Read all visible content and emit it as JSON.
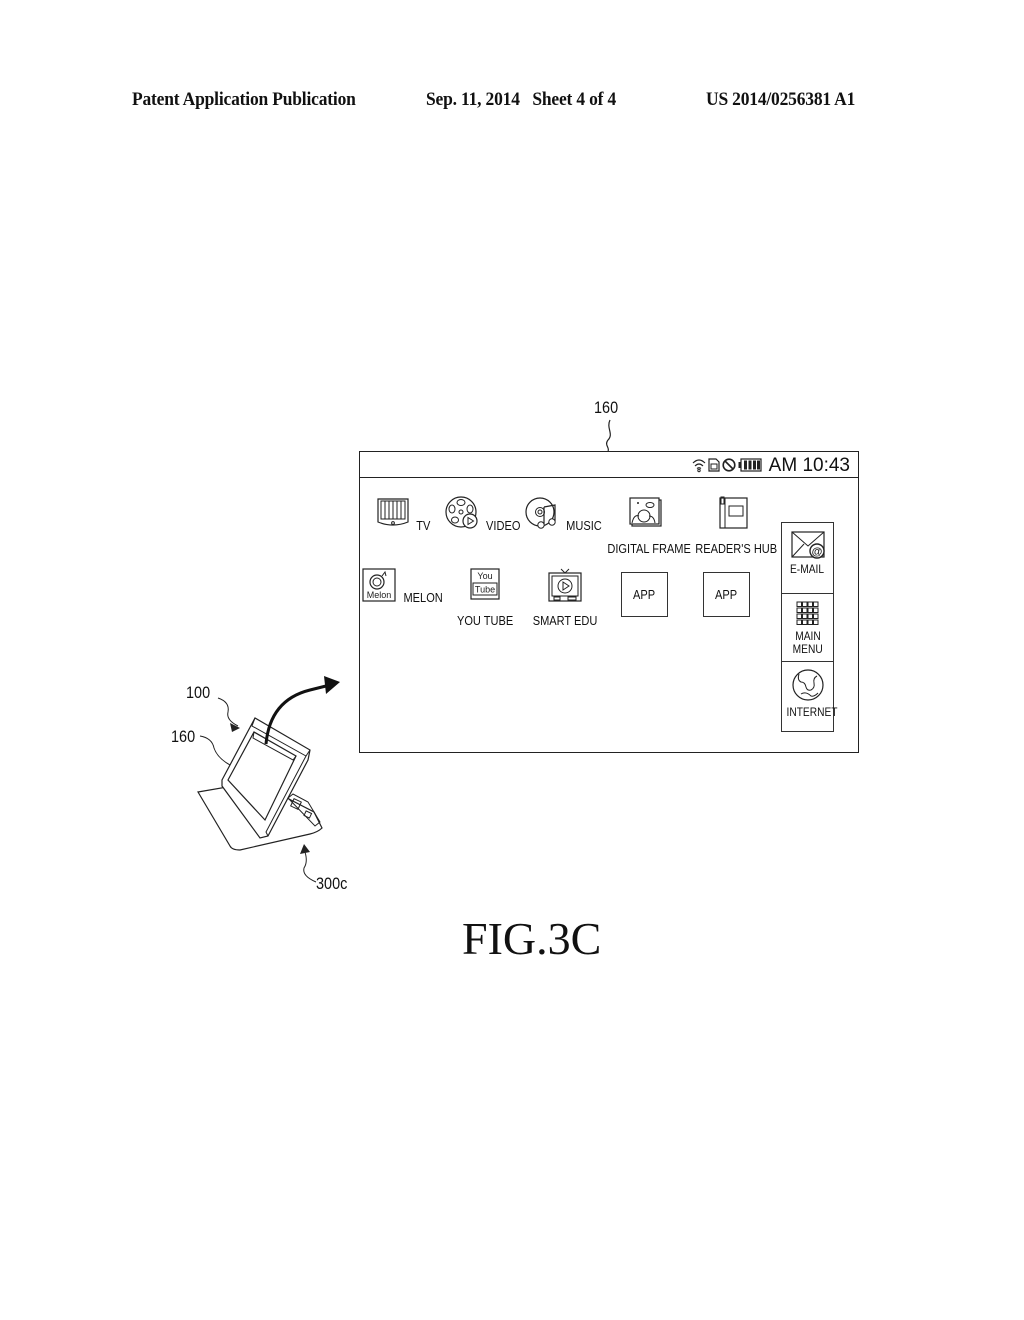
{
  "header": {
    "publication": "Patent Application Publication",
    "date_sheet": "Sep. 11, 2014   Sheet 4 of 4",
    "number": "US 2014/0256381 A1"
  },
  "figure": {
    "caption": "FIG.3C",
    "reference_labels": {
      "screen": "160",
      "device": "100",
      "device_screen": "160",
      "cover": "300c"
    }
  },
  "screen": {
    "status_bar": {
      "icons": [
        "wifi-icon",
        "sd-card-icon",
        "no-sign-icon",
        "battery-icon"
      ],
      "time": "AM 10:43"
    },
    "apps_row1": [
      {
        "label": "TV",
        "icon": "tv-icon"
      },
      {
        "label": "VIDEO",
        "icon": "film-reel-icon"
      },
      {
        "label": "MUSIC",
        "icon": "music-disc-icon"
      },
      {
        "label": "DIGITAL FRAME",
        "icon": "photo-frame-icon"
      },
      {
        "label": "READER'S HUB",
        "icon": "book-icon"
      }
    ],
    "apps_row2": [
      {
        "label": "MELON",
        "icon": "melon-icon",
        "icon_text": "Melon"
      },
      {
        "label": "YOU TUBE",
        "icon": "youtube-icon",
        "icon_text_top": "You",
        "icon_text_bottom": "Tube"
      },
      {
        "label": "SMART EDU",
        "icon": "tv-play-icon"
      }
    ],
    "placeholder_apps": [
      "APP",
      "APP"
    ],
    "dock": [
      {
        "label": "E-MAIL",
        "icon": "email-icon"
      },
      {
        "label_line1": "MAIN",
        "label_line2": "MENU",
        "icon": "grid-icon"
      },
      {
        "label": "INTERNET",
        "icon": "globe-icon"
      }
    ]
  }
}
